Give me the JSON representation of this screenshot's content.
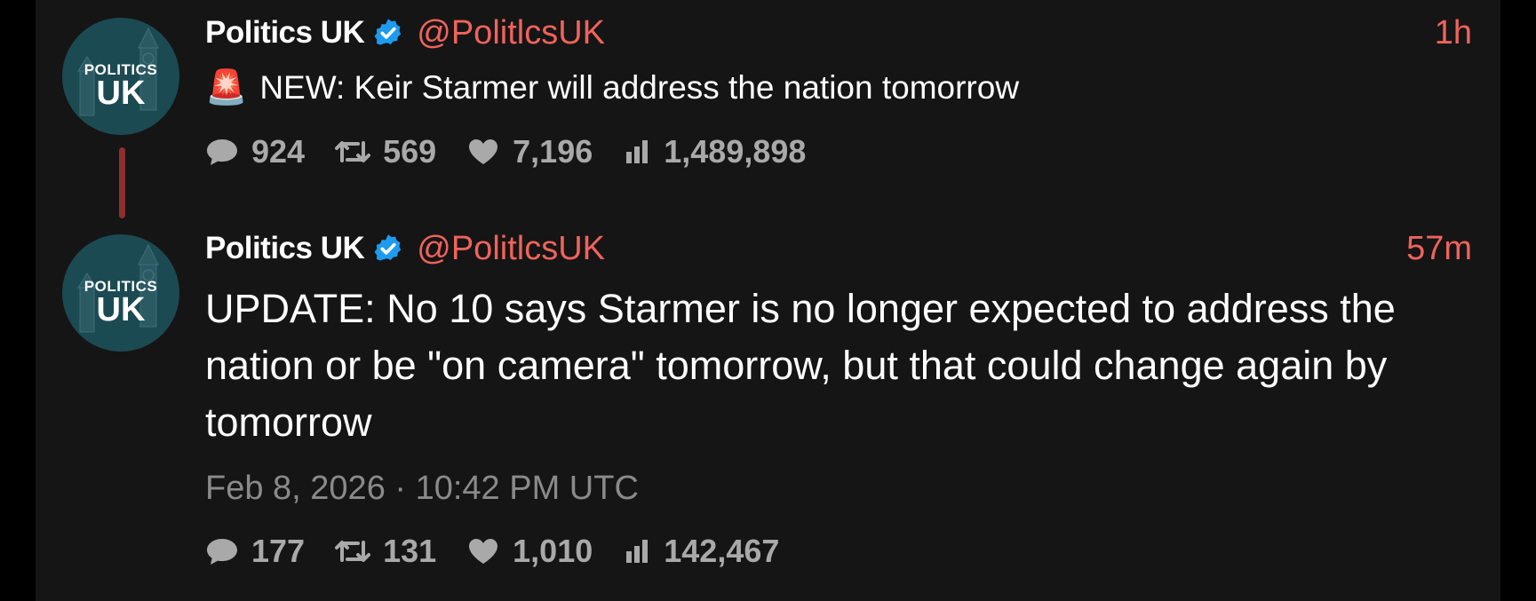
{
  "avatar": {
    "line1": "POLITICS",
    "line2": "UK"
  },
  "colors": {
    "background": "#151515",
    "accent": "#f0635c",
    "verified": "#1d9bf0",
    "thread_line": "#8e2e2e",
    "muted": "#8a8a8a"
  },
  "tweets": [
    {
      "author": "Politics UK",
      "verified": true,
      "handle": "@PolitlcsUK",
      "time": "1h",
      "emoji": "🚨",
      "text": "NEW: Keir Starmer will address the nation tomorrow",
      "stats": {
        "replies": "924",
        "retweets": "569",
        "likes": "7,196",
        "views": "1,489,898"
      }
    },
    {
      "author": "Politics UK",
      "verified": true,
      "handle": "@PolitlcsUK",
      "time": "57m",
      "text": "UPDATE: No 10 says Starmer is no longer expected to address the nation or be \"on camera\" tomorrow, but that could change again by tomorrow",
      "timestamp": "Feb 8, 2026 · 10:42 PM UTC",
      "stats": {
        "replies": "177",
        "retweets": "131",
        "likes": "1,010",
        "views": "142,467"
      }
    }
  ],
  "icons": {
    "reply": "speech-bubble-icon",
    "retweet": "retweet-icon",
    "like": "heart-icon",
    "views": "bar-chart-icon",
    "verified": "verified-badge-icon",
    "siren": "rotating-light-icon"
  }
}
